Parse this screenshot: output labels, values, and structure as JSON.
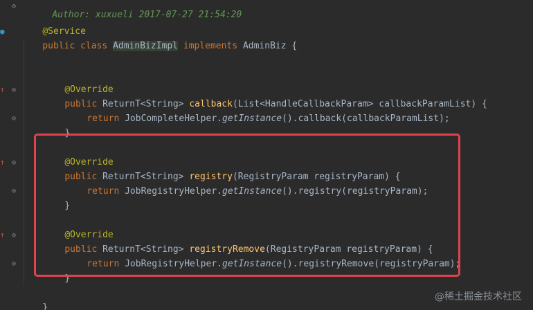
{
  "header_comment": "Author: xuxueli 2017-07-27 21:54:20",
  "annotation_service": "@Service",
  "class_decl": {
    "kw_public": "public",
    "kw_class": "class",
    "class_name_first": "A",
    "class_name_rest": "dminBizImpl",
    "kw_implements": "implements",
    "interface": "AdminBiz {"
  },
  "methods": [
    {
      "annotation": "@Override",
      "sig_kw": "public",
      "return_type": "ReturnT<String>",
      "name": "callback",
      "params": "(List<HandleCallbackParam> callbackParamList) {",
      "body_kw": "return",
      "body_recv": "JobCompleteHelper.",
      "body_static": "getInstance",
      "body_rest": "().callback(callbackParamList);",
      "close": "}"
    },
    {
      "annotation": "@Override",
      "sig_kw": "public",
      "return_type": "ReturnT<String>",
      "name": "registry",
      "params": "(RegistryParam registryParam) {",
      "body_kw": "return",
      "body_recv": "JobRegistryHelper.",
      "body_static": "getInstance",
      "body_rest": "().registry(registryParam);",
      "close": "}"
    },
    {
      "annotation": "@Override",
      "sig_kw": "public",
      "return_type": "ReturnT<String>",
      "name": "registryRemove",
      "params": "(RegistryParam registryParam) {",
      "body_kw": "return",
      "body_recv": "JobRegistryHelper.",
      "body_static": "getInstance",
      "body_rest": "().registryRemove(registryParam);",
      "close": "}"
    }
  ],
  "class_close": "}",
  "watermark": "@稀土掘金技术社区",
  "colors": {
    "background": "#2b2b2b",
    "keyword": "#cc7832",
    "annotation": "#bbb529",
    "method_name": "#ffc66d",
    "default_text": "#a9b7c6",
    "highlight_border": "#e0434d"
  },
  "gutter_icons": [
    "implements-icon",
    "override-arrow-icon",
    "fold-icon"
  ]
}
